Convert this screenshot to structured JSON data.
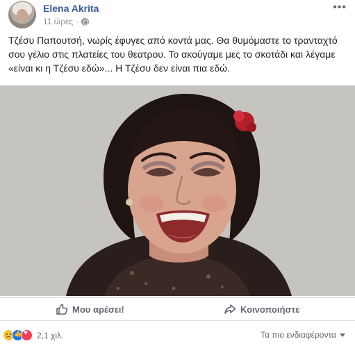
{
  "post": {
    "author": "Elena Akrita",
    "time": "11 ώρες",
    "separator": "·",
    "privacy_icon": "globe-icon",
    "more_icon": "more-dots-icon",
    "more_glyph": "•••",
    "text_lines": [
      "Τζέσυ Παπουτσή, νωρίς έφυγες από κοντά μας. Θα θυμόμαστε το τρανταχτό",
      "σου γέλιο στις πλατείες του θεατρου. Το ακούγαμε μες το σκοτάδι και λέγαμε",
      "«είναι κι η Τζέσυ εδώ»... Η Τζέσυ δεν είναι πια εδώ."
    ]
  },
  "actions": {
    "like_label": "Μου αρέσει!",
    "share_label": "Κοινοποιήστε"
  },
  "footer": {
    "reactions": [
      "sad-reaction-icon",
      "like-reaction-icon",
      "love-reaction-icon"
    ],
    "count": "2,1 χιλ.",
    "sort_label": "Τα πιο ενδιαφέροντα"
  },
  "colors": {
    "link": "#385898",
    "muted": "#90949c",
    "action": "#606770",
    "like_blue": "#1877f2",
    "love_red": "#f33e58",
    "sad_yellow": "#f5c33b"
  }
}
